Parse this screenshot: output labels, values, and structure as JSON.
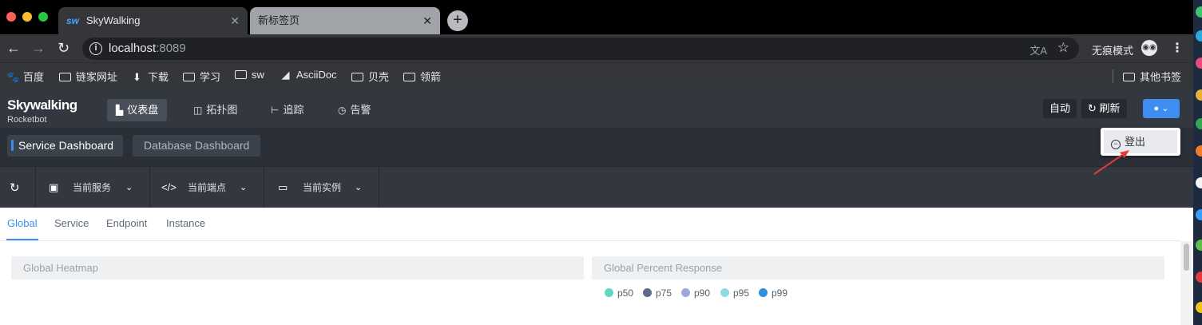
{
  "browser": {
    "tabs": [
      {
        "title": "SkyWalking",
        "favicon": "sw",
        "active": true
      },
      {
        "title": "新标签页",
        "active": false
      }
    ],
    "url_host": "localhost",
    "url_port": ":8089",
    "incognito_label": "无痕模式",
    "bookmarks": [
      {
        "label": "百度",
        "icon": "baidu-icon"
      },
      {
        "label": "链家网址",
        "icon": "folder-icon"
      },
      {
        "label": "下载",
        "icon": "download-icon"
      },
      {
        "label": "学习",
        "icon": "folder-icon"
      },
      {
        "label": "sw",
        "icon": "folder-icon"
      },
      {
        "label": "AsciiDoc",
        "icon": "asciidoc-icon"
      },
      {
        "label": "贝壳",
        "icon": "folder-icon"
      },
      {
        "label": "领箭",
        "icon": "folder-icon"
      }
    ],
    "other_bookmarks": "其他书签"
  },
  "app": {
    "logo": "Skywalking",
    "logo_sub": "Rocketbot",
    "nav": [
      {
        "label": "仪表盘",
        "icon": "chart-icon",
        "active": true
      },
      {
        "label": "拓扑图",
        "icon": "topology-icon",
        "active": false
      },
      {
        "label": "追踪",
        "icon": "trace-icon",
        "active": false
      },
      {
        "label": "告警",
        "icon": "alarm-icon",
        "active": false
      }
    ],
    "auto_label": "自动",
    "refresh_label": "刷新",
    "user_menu": {
      "logout_label": "登出"
    }
  },
  "dashboards": [
    {
      "label": "Service Dashboard",
      "active": true
    },
    {
      "label": "Database Dashboard",
      "active": false
    }
  ],
  "selectors": [
    {
      "label": "当前服务",
      "icon": "lock-icon"
    },
    {
      "label": "当前端点",
      "icon": "code-icon"
    },
    {
      "label": "当前实例",
      "icon": "laptop-icon"
    }
  ],
  "sub_tabs": [
    {
      "label": "Global",
      "active": true
    },
    {
      "label": "Service",
      "active": false
    },
    {
      "label": "Endpoint",
      "active": false
    },
    {
      "label": "Instance",
      "active": false
    }
  ],
  "panels": {
    "heatmap_title": "Global Heatmap",
    "percent_title": "Global Percent Response",
    "legend": [
      {
        "label": "p50",
        "color": "#5ed9c3"
      },
      {
        "label": "p75",
        "color": "#5a6b8c"
      },
      {
        "label": "p90",
        "color": "#9ea8dc"
      },
      {
        "label": "p95",
        "color": "#8fdbe3"
      },
      {
        "label": "p99",
        "color": "#2f8fe0"
      }
    ]
  },
  "colors": {
    "accent": "#3d8ef0",
    "header_bg": "#333840"
  }
}
